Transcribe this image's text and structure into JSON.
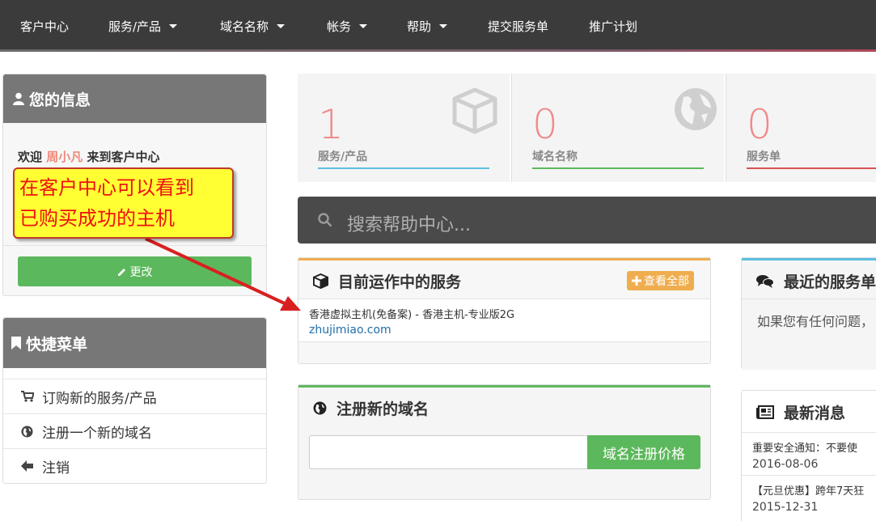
{
  "nav": {
    "items": [
      {
        "label": "客户中心",
        "dropdown": false
      },
      {
        "label": "服务/产品",
        "dropdown": true
      },
      {
        "label": "域名名称",
        "dropdown": true
      },
      {
        "label": "帐务",
        "dropdown": true
      },
      {
        "label": "帮助",
        "dropdown": true
      },
      {
        "label": "提交服务单",
        "dropdown": false
      },
      {
        "label": "推广计划",
        "dropdown": false
      }
    ]
  },
  "user_panel": {
    "title": "您的信息",
    "welcome_prefix": "欢迎",
    "username": "周小凡",
    "welcome_suffix": "来到客户中心",
    "edit_button": "更改"
  },
  "quick_menu": {
    "title": "快捷菜单",
    "items": [
      {
        "label": "订购新的服务/产品",
        "icon": "cart-icon"
      },
      {
        "label": "注册一个新的域名",
        "icon": "globe-icon"
      },
      {
        "label": "注销",
        "icon": "arrow-left-icon"
      }
    ]
  },
  "stats": [
    {
      "value": "1",
      "label": "服务/产品",
      "icon": "cube-icon",
      "color": "#5bc0de"
    },
    {
      "value": "0",
      "label": "域名名称",
      "icon": "globe-icon",
      "color": "#5cb85c"
    },
    {
      "value": "0",
      "label": "服务单",
      "icon": "ticket-icon",
      "color": "#d9534f"
    }
  ],
  "search": {
    "placeholder": "搜索帮助中心..."
  },
  "services_panel": {
    "title": "目前运作中的服务",
    "view_all": "查看全部",
    "service_name": "香港虚拟主机(免备案) - 香港主机-专业版2G",
    "service_domain": "zhujimiao.com"
  },
  "domain_panel": {
    "title": "注册新的域名",
    "input_value": "",
    "button": "域名注册价格"
  },
  "tickets_panel": {
    "title": "最近的服务单",
    "body": "如果您有任何问题，"
  },
  "news_panel": {
    "title": "最新消息",
    "items": [
      {
        "title": "重要安全通知：不要使",
        "date": "2016-08-06"
      },
      {
        "title": "【元旦优惠】跨年7天狂",
        "date": "2015-12-31"
      }
    ]
  },
  "annotation": {
    "line1": "在客户中心可以看到",
    "line2": "已购买成功的主机"
  },
  "colors": {
    "nav_bg": "#3b3b3b",
    "accent_red": "#f08a8a",
    "green": "#5cb85c",
    "orange": "#f0ad4e",
    "link": "#1f6fa8"
  }
}
